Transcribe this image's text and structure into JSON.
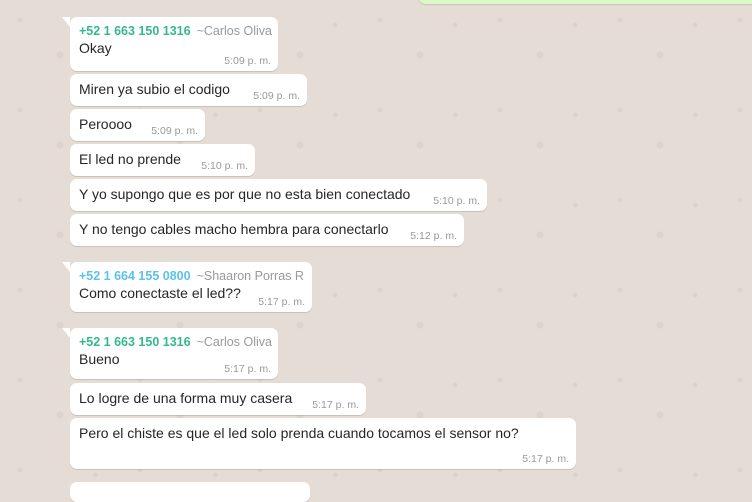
{
  "colors": {
    "carlos": "#35b88f",
    "shaaron": "#5bc3e8"
  },
  "messages": [
    {
      "phone": "+52 1 663 150 1316",
      "alias": "~Carlos Oliva",
      "text": "Okay",
      "time": "5:09 p. m."
    },
    {
      "text": "Miren ya subio el codigo",
      "time": "5:09 p. m."
    },
    {
      "text": "Peroooo",
      "time": "5:09 p. m."
    },
    {
      "text": "El led no prende",
      "time": "5:10 p. m."
    },
    {
      "text": "Y yo supongo que es por que no esta bien conectado",
      "time": "5:10 p. m."
    },
    {
      "text": "Y no tengo cables macho hembra para conectarlo",
      "time": "5:12 p. m."
    },
    {
      "phone": "+52 1 664 155 0800",
      "alias": "~Shaaron Porras R",
      "text": "Como conectaste el led??",
      "time": "5:17 p. m."
    },
    {
      "phone": "+52 1 663 150 1316",
      "alias": "~Carlos Oliva",
      "text": "Bueno",
      "time": "5:17 p. m."
    },
    {
      "text": "Lo logre de una forma muy casera",
      "time": "5:17 p. m."
    },
    {
      "text": "Pero el chiste es que el led solo prenda cuando tocamos el sensor no?",
      "time": "5:17 p. m."
    }
  ]
}
